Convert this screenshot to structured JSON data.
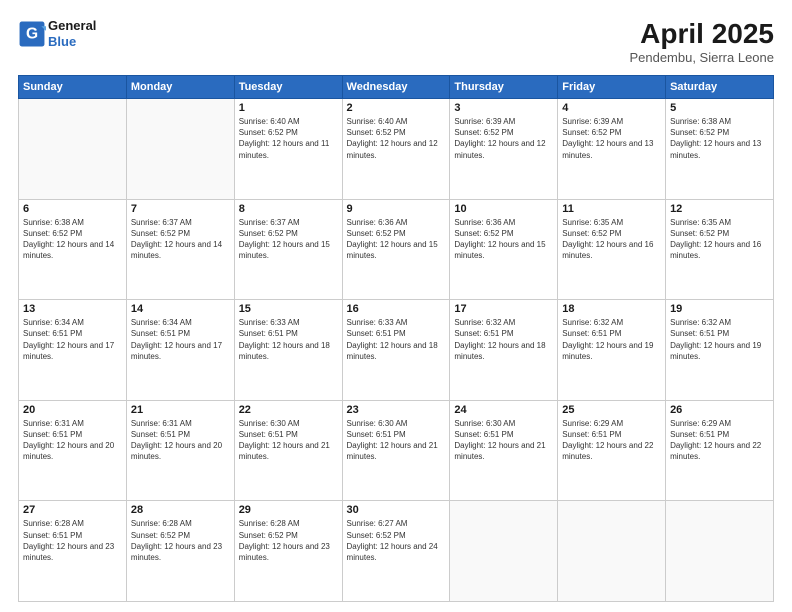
{
  "header": {
    "logo_line1": "General",
    "logo_line2": "Blue",
    "month_title": "April 2025",
    "subtitle": "Pendembu, Sierra Leone"
  },
  "weekdays": [
    "Sunday",
    "Monday",
    "Tuesday",
    "Wednesday",
    "Thursday",
    "Friday",
    "Saturday"
  ],
  "weeks": [
    [
      {
        "day": "",
        "info": ""
      },
      {
        "day": "",
        "info": ""
      },
      {
        "day": "1",
        "info": "Sunrise: 6:40 AM\nSunset: 6:52 PM\nDaylight: 12 hours and 11 minutes."
      },
      {
        "day": "2",
        "info": "Sunrise: 6:40 AM\nSunset: 6:52 PM\nDaylight: 12 hours and 12 minutes."
      },
      {
        "day": "3",
        "info": "Sunrise: 6:39 AM\nSunset: 6:52 PM\nDaylight: 12 hours and 12 minutes."
      },
      {
        "day": "4",
        "info": "Sunrise: 6:39 AM\nSunset: 6:52 PM\nDaylight: 12 hours and 13 minutes."
      },
      {
        "day": "5",
        "info": "Sunrise: 6:38 AM\nSunset: 6:52 PM\nDaylight: 12 hours and 13 minutes."
      }
    ],
    [
      {
        "day": "6",
        "info": "Sunrise: 6:38 AM\nSunset: 6:52 PM\nDaylight: 12 hours and 14 minutes."
      },
      {
        "day": "7",
        "info": "Sunrise: 6:37 AM\nSunset: 6:52 PM\nDaylight: 12 hours and 14 minutes."
      },
      {
        "day": "8",
        "info": "Sunrise: 6:37 AM\nSunset: 6:52 PM\nDaylight: 12 hours and 15 minutes."
      },
      {
        "day": "9",
        "info": "Sunrise: 6:36 AM\nSunset: 6:52 PM\nDaylight: 12 hours and 15 minutes."
      },
      {
        "day": "10",
        "info": "Sunrise: 6:36 AM\nSunset: 6:52 PM\nDaylight: 12 hours and 15 minutes."
      },
      {
        "day": "11",
        "info": "Sunrise: 6:35 AM\nSunset: 6:52 PM\nDaylight: 12 hours and 16 minutes."
      },
      {
        "day": "12",
        "info": "Sunrise: 6:35 AM\nSunset: 6:52 PM\nDaylight: 12 hours and 16 minutes."
      }
    ],
    [
      {
        "day": "13",
        "info": "Sunrise: 6:34 AM\nSunset: 6:51 PM\nDaylight: 12 hours and 17 minutes."
      },
      {
        "day": "14",
        "info": "Sunrise: 6:34 AM\nSunset: 6:51 PM\nDaylight: 12 hours and 17 minutes."
      },
      {
        "day": "15",
        "info": "Sunrise: 6:33 AM\nSunset: 6:51 PM\nDaylight: 12 hours and 18 minutes."
      },
      {
        "day": "16",
        "info": "Sunrise: 6:33 AM\nSunset: 6:51 PM\nDaylight: 12 hours and 18 minutes."
      },
      {
        "day": "17",
        "info": "Sunrise: 6:32 AM\nSunset: 6:51 PM\nDaylight: 12 hours and 18 minutes."
      },
      {
        "day": "18",
        "info": "Sunrise: 6:32 AM\nSunset: 6:51 PM\nDaylight: 12 hours and 19 minutes."
      },
      {
        "day": "19",
        "info": "Sunrise: 6:32 AM\nSunset: 6:51 PM\nDaylight: 12 hours and 19 minutes."
      }
    ],
    [
      {
        "day": "20",
        "info": "Sunrise: 6:31 AM\nSunset: 6:51 PM\nDaylight: 12 hours and 20 minutes."
      },
      {
        "day": "21",
        "info": "Sunrise: 6:31 AM\nSunset: 6:51 PM\nDaylight: 12 hours and 20 minutes."
      },
      {
        "day": "22",
        "info": "Sunrise: 6:30 AM\nSunset: 6:51 PM\nDaylight: 12 hours and 21 minutes."
      },
      {
        "day": "23",
        "info": "Sunrise: 6:30 AM\nSunset: 6:51 PM\nDaylight: 12 hours and 21 minutes."
      },
      {
        "day": "24",
        "info": "Sunrise: 6:30 AM\nSunset: 6:51 PM\nDaylight: 12 hours and 21 minutes."
      },
      {
        "day": "25",
        "info": "Sunrise: 6:29 AM\nSunset: 6:51 PM\nDaylight: 12 hours and 22 minutes."
      },
      {
        "day": "26",
        "info": "Sunrise: 6:29 AM\nSunset: 6:51 PM\nDaylight: 12 hours and 22 minutes."
      }
    ],
    [
      {
        "day": "27",
        "info": "Sunrise: 6:28 AM\nSunset: 6:51 PM\nDaylight: 12 hours and 23 minutes."
      },
      {
        "day": "28",
        "info": "Sunrise: 6:28 AM\nSunset: 6:52 PM\nDaylight: 12 hours and 23 minutes."
      },
      {
        "day": "29",
        "info": "Sunrise: 6:28 AM\nSunset: 6:52 PM\nDaylight: 12 hours and 23 minutes."
      },
      {
        "day": "30",
        "info": "Sunrise: 6:27 AM\nSunset: 6:52 PM\nDaylight: 12 hours and 24 minutes."
      },
      {
        "day": "",
        "info": ""
      },
      {
        "day": "",
        "info": ""
      },
      {
        "day": "",
        "info": ""
      }
    ]
  ]
}
